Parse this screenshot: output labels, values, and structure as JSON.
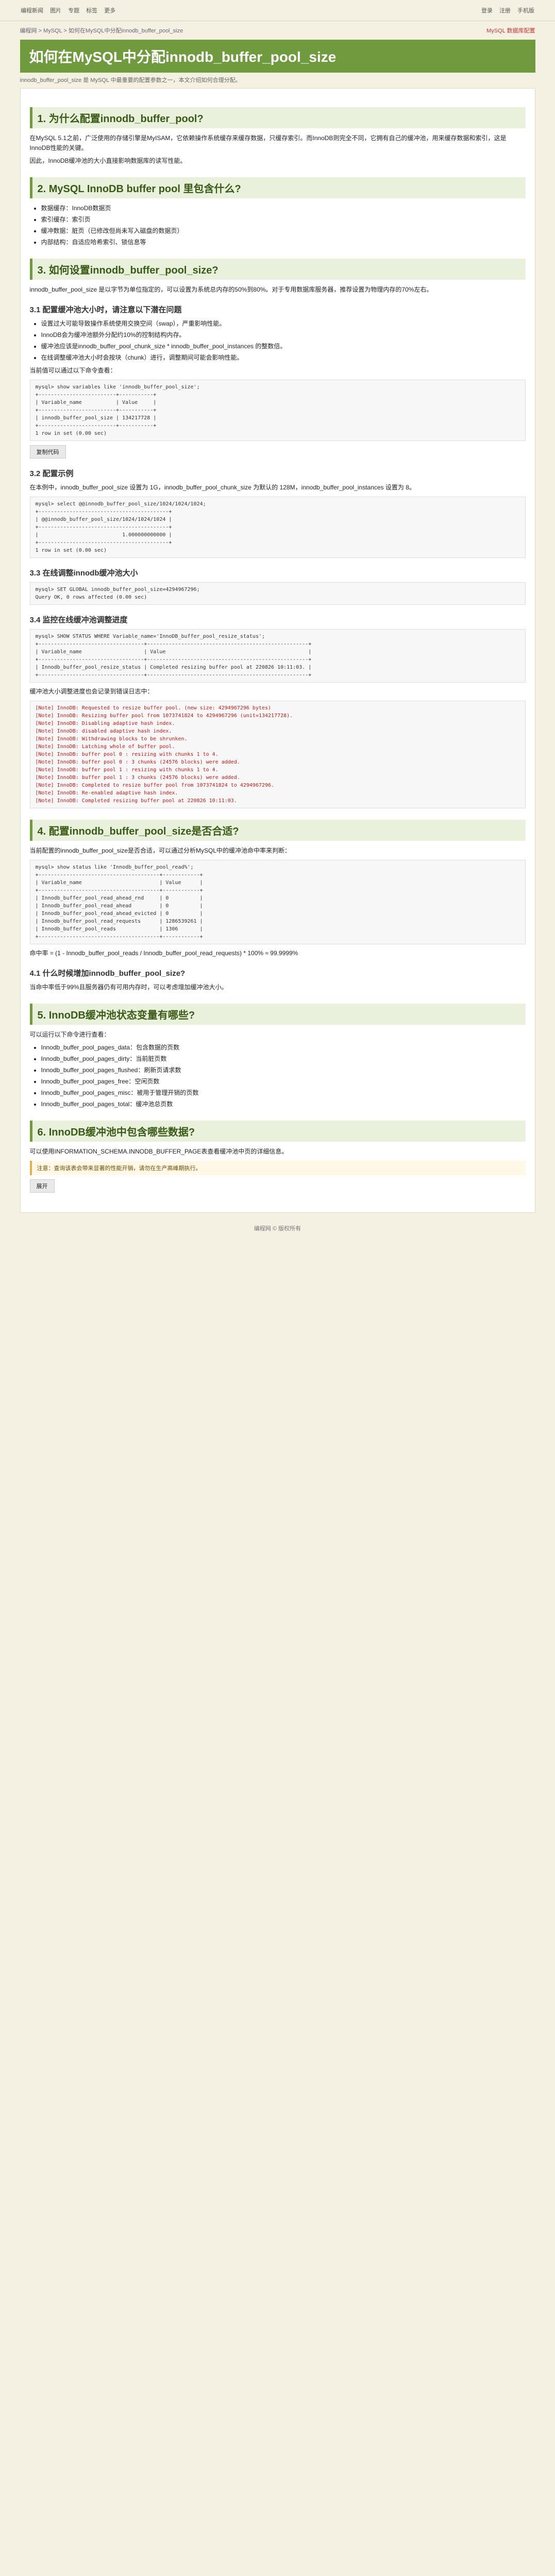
{
  "topbar": {
    "left": [
      "编程新闻",
      "图片",
      "专题",
      "标签",
      "更多"
    ],
    "right": [
      "登录",
      "注册",
      "手机版"
    ]
  },
  "breadcrumb": {
    "path": "编程网 > MySQL > 如何在MySQL中分配innodb_buffer_pool_size",
    "tag": "MySQL 数据库配置"
  },
  "title": "如何在MySQL中分配innodb_buffer_pool_size",
  "meta": {
    "text": "innodb_buffer_pool_size 是 MySQL 中最重要的配置参数之一，本文介绍如何合理分配。",
    "highlight": "innodb_buffer_pool_size"
  },
  "s1": {
    "heading": "1. 为什么配置innodb_buffer_pool?",
    "p1": "在MySQL 5.1之前，广泛使用的存储引擎是MyISAM，它依赖操作系统缓存来缓存数据，只缓存索引。而InnoDB则完全不同，它拥有自己的缓冲池，用来缓存数据和索引，这是InnoDB性能的关键。",
    "p2": "因此，InnoDB缓冲池的大小直接影响数据库的读写性能。"
  },
  "s2": {
    "heading": "2. MySQL InnoDB buffer pool 里包含什么?",
    "items": [
      "数据缓存：InnoDB数据页",
      "索引缓存：索引页",
      "缓冲数据：脏页（已修改但尚未写入磁盘的数据页）",
      "内部结构：自适应哈希索引、锁信息等"
    ]
  },
  "s3": {
    "heading": "3. 如何设置innodb_buffer_pool_size?",
    "p1": "innodb_buffer_pool_size 是以字节为单位指定的，可以设置为系统总内存的50%到80%。对于专用数据库服务器，推荐设置为物理内存的70%左右。",
    "sub1": "3.1 配置缓冲池大小时，请注意以下潜在问题",
    "items": [
      "设置过大可能导致操作系统使用交换空间（swap），严重影响性能。",
      "InnoDB会为缓冲池额外分配约10%的控制结构内存。",
      "缓冲池应该是innodb_buffer_pool_chunk_size * innodb_buffer_pool_instances 的整数倍。",
      "在线调整缓冲池大小时会按块（chunk）进行，调整期间可能会影响性能。"
    ],
    "p2": "当前值可以通过以下命令查看：",
    "code1": [
      "mysql> show variables like 'innodb_buffer_pool_size';",
      "+-------------------------+-----------+",
      "| Variable_name           | Value     |",
      "+-------------------------+-----------+",
      "| innodb_buffer_pool_size | 134217728 |",
      "+-------------------------+-----------+",
      "1 row in set (0.00 sec)"
    ],
    "sub2": "3.2 配置示例",
    "p3": "在本例中，innodb_buffer_pool_size 设置为 1G，innodb_buffer_pool_chunk_size 为默认的 128M，innodb_buffer_pool_instances 设置为 8。",
    "code2": [
      "mysql> select @@innodb_buffer_pool_size/1024/1024/1024;",
      "+------------------------------------------+",
      "| @@innodb_buffer_pool_size/1024/1024/1024 |",
      "+------------------------------------------+",
      "|                           1.000000000000 |",
      "+------------------------------------------+",
      "1 row in set (0.00 sec)"
    ],
    "sub3": "3.3 在线调整innodb缓冲池大小",
    "code3": [
      "mysql> SET GLOBAL innodb_buffer_pool_size=4294967296;",
      "Query OK, 0 rows affected (0.00 sec)"
    ],
    "sub4": "3.4 监控在线缓冲池调整进度",
    "code4": [
      "mysql> SHOW STATUS WHERE Variable_name='InnoDB_buffer_pool_resize_status';",
      "+----------------------------------+----------------------------------------------------+",
      "| Variable_name                    | Value                                              |",
      "+----------------------------------+----------------------------------------------------+",
      "| Innodb_buffer_pool_resize_status | Completed resizing buffer pool at 220826 10:11:03. |",
      "+----------------------------------+----------------------------------------------------+"
    ],
    "p4": "缓冲池大小调整进度也会记录到错误日志中：",
    "log": [
      "[Note] InnoDB: Requested to resize buffer pool. (new size: 4294967296 bytes)",
      "[Note] InnoDB: Resizing buffer pool from 1073741824 to 4294967296 (unit=134217728).",
      "[Note] InnoDB: Disabling adaptive hash index.",
      "[Note] InnoDB: disabled adaptive hash index.",
      "[Note] InnoDB: Withdrawing blocks to be shrunken.",
      "[Note] InnoDB: Latching whole of buffer pool.",
      "[Note] InnoDB: buffer pool 0 : resizing with chunks 1 to 4.",
      "[Note] InnoDB: buffer pool 0 : 3 chunks (24576 blocks) were added.",
      "[Note] InnoDB: buffer pool 1 : resizing with chunks 1 to 4.",
      "[Note] InnoDB: buffer pool 1 : 3 chunks (24576 blocks) were added.",
      "[Note] InnoDB: Completed to resize buffer pool from 1073741824 to 4294967296.",
      "[Note] InnoDB: Re-enabled adaptive hash index.",
      "[Note] InnoDB: Completed resizing buffer pool at 220826 10:11:03."
    ]
  },
  "s4": {
    "heading": "4. 配置innodb_buffer_pool_size是否合适?",
    "p1": "当前配置的innodb_buffer_pool_size是否合适，可以通过分析MySQL中的缓冲池命中率来判断：",
    "code1": [
      "mysql> show status like 'Innodb_buffer_pool_read%';",
      "+---------------------------------------+------------+",
      "| Variable_name                         | Value      |",
      "+---------------------------------------+------------+",
      "| Innodb_buffer_pool_read_ahead_rnd     | 0          |",
      "| Innodb_buffer_pool_read_ahead         | 0          |",
      "| Innodb_buffer_pool_read_ahead_evicted | 0          |",
      "| Innodb_buffer_pool_read_requests      | 1286539261 |",
      "| Innodb_buffer_pool_reads              | 1306       |",
      "+---------------------------------------+------------+"
    ],
    "p2": "命中率 = (1 - Innodb_buffer_pool_reads / Innodb_buffer_pool_read_requests) * 100% ≈ 99.9999%",
    "sub1": "4.1 什么时候增加innodb_buffer_pool_size?",
    "p3": "当命中率低于99%且服务器仍有可用内存时，可以考虑增加缓冲池大小。"
  },
  "s5": {
    "heading": "5. InnoDB缓冲池状态变量有哪些?",
    "p1": "可以运行以下命令进行查看：",
    "items": [
      "Innodb_buffer_pool_pages_data：包含数据的页数",
      "Innodb_buffer_pool_pages_dirty：当前脏页数",
      "Innodb_buffer_pool_pages_flushed：刷新页请求数",
      "Innodb_buffer_pool_pages_free：空闲页数",
      "Innodb_buffer_pool_pages_misc：被用于管理开销的页数",
      "Innodb_buffer_pool_pages_total：缓冲池总页数"
    ]
  },
  "s6": {
    "heading": "6. InnoDB缓冲池中包含哪些数据?",
    "p1": "可以使用INFORMATION_SCHEMA.INNODB_BUFFER_PAGE表查看缓冲池中页的详细信息。",
    "note": "注意：查询该表会带来显著的性能开销，请勿在生产高峰期执行。"
  },
  "buttons": {
    "copy": "复制代码",
    "expand": "展开"
  },
  "footer": "编程网 © 版权所有"
}
